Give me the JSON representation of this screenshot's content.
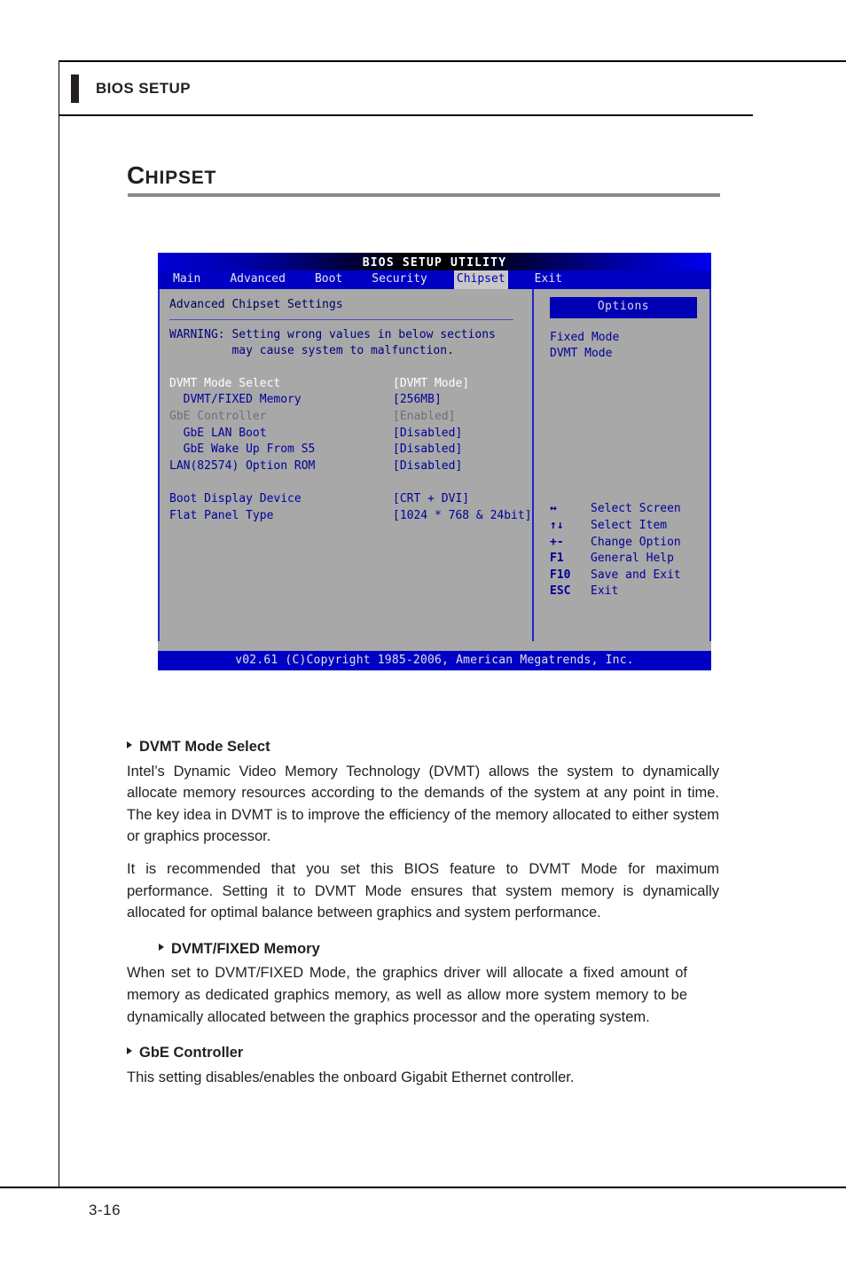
{
  "running_head": {
    "title": "BIOS SETUP"
  },
  "section": {
    "cap": "C",
    "rest": "HIPSET"
  },
  "bios": {
    "title": "BIOS SETUP UTILITY",
    "tabs": [
      {
        "label": "Main",
        "selected": false
      },
      {
        "label": "Advanced",
        "selected": false
      },
      {
        "label": "Boot",
        "selected": false
      },
      {
        "label": "Security",
        "selected": false
      },
      {
        "label": "Chipset",
        "selected": true
      },
      {
        "label": "Exit",
        "selected": false
      }
    ],
    "heading": "Advanced Chipset Settings",
    "warning": "WARNING: Setting wrong values in below sections\n         may cause system to malfunction.",
    "settings": [
      {
        "label": "DVMT Mode Select",
        "value": "[DVMT Mode]",
        "state": "selected"
      },
      {
        "label": "  DVMT/FIXED Memory",
        "value": "[256MB]",
        "state": "normal"
      },
      {
        "label": "GbE Controller",
        "value": "[Enabled]",
        "state": "dim"
      },
      {
        "label": "  GbE LAN Boot",
        "value": "[Disabled]",
        "state": "normal"
      },
      {
        "label": "  GbE Wake Up From S5",
        "value": "[Disabled]",
        "state": "normal"
      },
      {
        "label": "LAN(82574) Option ROM",
        "value": "[Disabled]",
        "state": "normal"
      },
      {
        "label": "",
        "value": "",
        "state": "gap"
      },
      {
        "label": "Boot Display Device",
        "value": "[CRT + DVI]",
        "state": "normal"
      },
      {
        "label": "Flat Panel Type",
        "value": "[1024 * 768 & 24bit]",
        "state": "normal"
      }
    ],
    "options_header": "Options",
    "options": [
      "Fixed Mode",
      "DVMT Mode"
    ],
    "keys": [
      {
        "key": "↔",
        "action": "Select Screen"
      },
      {
        "key": "↑↓",
        "action": "Select Item"
      },
      {
        "key": "+-",
        "action": "Change Option"
      },
      {
        "key": "F1",
        "action": "General Help"
      },
      {
        "key": "F10",
        "action": "Save and Exit"
      },
      {
        "key": "ESC",
        "action": "Exit"
      }
    ],
    "footer": "v02.61 (C)Copyright 1985-2006, American Megatrends, Inc."
  },
  "prose": {
    "dvmt_mode_select_head": "DVMT Mode Select",
    "dvmt_p1": "Intel’s Dynamic Video Memory Technology (DVMT) allows the system to dynamically allocate memory resources according to the demands of the system at any point in time. The key idea in DVMT is to improve the efficiency of the memory allocated to either system or graphics processor.",
    "dvmt_p2": "It is recommended that you set this BIOS feature to DVMT Mode for maximum performance. Setting it to DVMT Mode ensures that system memory is dynamically allocated for optimal balance between graphics and system performance.",
    "dvmt_fixed_head": "DVMT/FIXED Memory",
    "dvmt_fixed_p1": "When set to DVMT/FIXED Mode, the graphics driver will allocate a fixed amount of memory as dedicated graphics memory, as well as allow more system memory to be dynamically allocated between the graphics processor and the operating system.",
    "gbe_head": "GbE Controller",
    "gbe_p1": "This setting disables/enables the onboard Gigabit Ethernet controller."
  },
  "page_number": "3-16"
}
